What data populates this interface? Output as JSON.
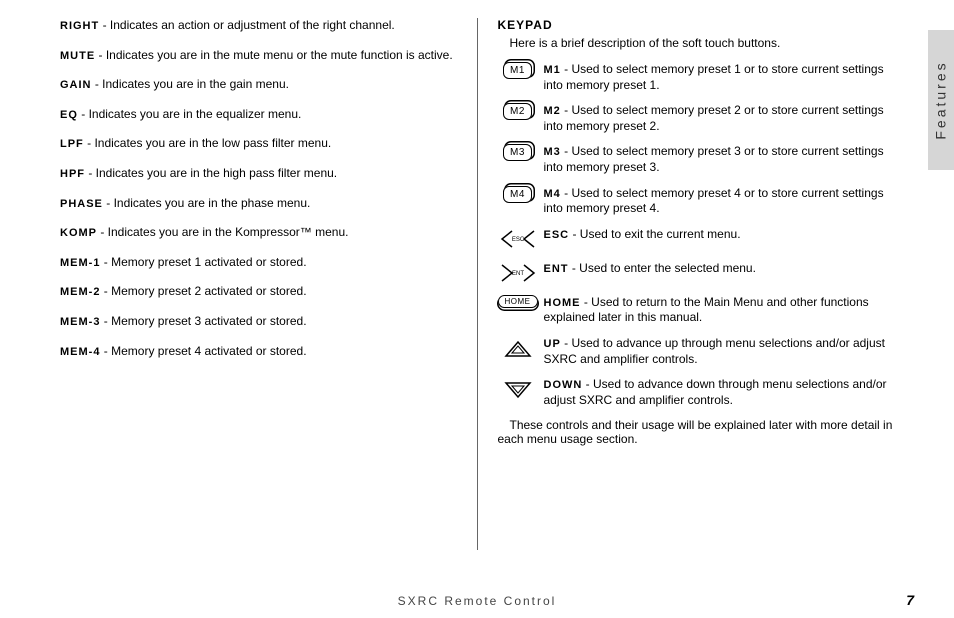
{
  "side_tab": "Features",
  "footer": "SXRC Remote Control",
  "page_number": "7",
  "left": [
    {
      "term": "RIGHT",
      "desc": " - Indicates an action or adjustment of the right channel."
    },
    {
      "term": "MUTE",
      "desc": " - Indicates you are in the mute menu or the mute function is active."
    },
    {
      "term": "GAIN",
      "desc": " - Indicates you are in the gain menu."
    },
    {
      "term": "EQ",
      "desc": " - Indicates you are in the equalizer menu."
    },
    {
      "term": "LPF",
      "desc": " - Indicates you are in the low pass filter menu."
    },
    {
      "term": "HPF",
      "desc": " - Indicates you are in the high pass filter menu."
    },
    {
      "term": "PHASE",
      "desc": " - Indicates you are in the phase menu."
    },
    {
      "term": "KOMP",
      "desc": " - Indicates you are in the Kompressor™ menu."
    },
    {
      "term": "MEM-1",
      "desc": " - Memory preset 1 activated or stored."
    },
    {
      "term": "MEM-2",
      "desc": " - Memory preset 2 activated or stored."
    },
    {
      "term": "MEM-3",
      "desc": " - Memory preset 3 activated or stored."
    },
    {
      "term": "MEM-4",
      "desc": " - Memory preset 4 activated or stored."
    }
  ],
  "right": {
    "heading": "KEYPAD",
    "intro": "Here is a brief description of the soft touch buttons.",
    "outro": "These controls and their usage will be explained later with more detail in each menu usage section.",
    "items": [
      {
        "icon": "m1",
        "iconText": "M1",
        "term": "M1",
        "desc": " - Used to select memory preset 1 or to store current settings into memory preset 1."
      },
      {
        "icon": "m2",
        "iconText": "M2",
        "term": "M2",
        "desc": " - Used to select memory preset 2 or to store current settings into memory preset 2."
      },
      {
        "icon": "m3",
        "iconText": "M3",
        "term": "M3",
        "desc": " - Used to select memory preset 3 or to store current settings into memory preset 3."
      },
      {
        "icon": "m4",
        "iconText": "M4",
        "term": "M4",
        "desc": " - Used to select memory preset 4 or to store current settings into memory preset 4."
      },
      {
        "icon": "esc",
        "iconText": "ESC",
        "term": "ESC",
        "desc": " - Used to exit the current menu."
      },
      {
        "icon": "ent",
        "iconText": "ENT",
        "term": "ENT",
        "desc": " - Used to enter the selected menu."
      },
      {
        "icon": "home",
        "iconText": "HOME",
        "term": "HOME",
        "desc": " - Used to return to the Main Menu and other functions explained later in this manual."
      },
      {
        "icon": "up",
        "iconText": "",
        "term": "UP",
        "desc": " - Used to advance up through menu selections and/or adjust SXRC and amplifier controls."
      },
      {
        "icon": "down",
        "iconText": "",
        "term": "DOWN",
        "desc": " - Used to advance down through menu selections and/or adjust SXRC and amplifier controls."
      }
    ]
  }
}
